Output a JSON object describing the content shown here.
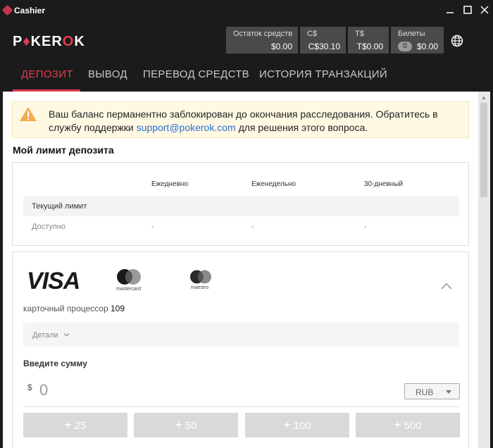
{
  "window": {
    "title": "Cashier",
    "controls": [
      "minimize",
      "maximize",
      "close"
    ]
  },
  "brand": {
    "logo_left": "P",
    "logo_mid": "KER",
    "logo_accent": "O",
    "logo_right": "K",
    "accent_color": "#e33b4e"
  },
  "balances": [
    {
      "label": "Остаток средств",
      "value": "$0.00"
    },
    {
      "label": "C$",
      "value": "C$30.10"
    },
    {
      "label": "T$",
      "value": "T$0.00"
    },
    {
      "label": "Билеты",
      "count": "0",
      "value": "$0.00"
    }
  ],
  "tabs": [
    {
      "label": "ДЕПОЗИТ",
      "active": true
    },
    {
      "label": "ВЫВОД",
      "active": false
    },
    {
      "label": "ПЕРЕВОД СРЕДСТВ",
      "active": false
    },
    {
      "label": "ИСТОРИЯ ТРАНЗАКЦИЙ",
      "active": false
    }
  ],
  "warning": {
    "text_before": "Ваш баланс перманентно заблокирован до окончания расследования. Обратитесь в службу поддержки ",
    "link": "support@pokerok.com",
    "text_after": " для решения этого вопроса."
  },
  "limits": {
    "title": "Мой лимит депозита",
    "columns": [
      "Ежедневно",
      "Еженедельно",
      "30-дневный"
    ],
    "rows": [
      {
        "label": "Текущий лимит",
        "values": [
          "",
          "",
          ""
        ]
      },
      {
        "label": "Доступно",
        "values": [
          "-",
          "-",
          "-"
        ]
      }
    ]
  },
  "deposit": {
    "brands": {
      "visa": "VISA",
      "mastercard": "mastercard",
      "maestro": "maestro"
    },
    "processor_label": "карточный процессор",
    "processor_num": "109",
    "details_label": "Детали",
    "enter_label": "Введите сумму",
    "currency_symbol": "$",
    "amount": "0",
    "currency": "RUB",
    "quick_amounts": [
      "25",
      "50",
      "100",
      "500"
    ]
  }
}
